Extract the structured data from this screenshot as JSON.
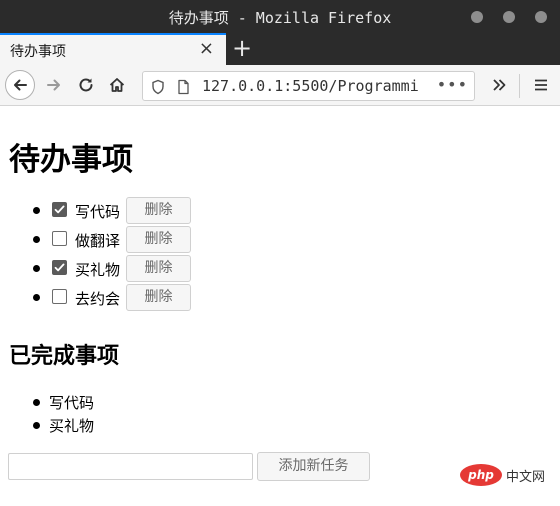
{
  "window": {
    "title": "待办事项 - Mozilla Firefox"
  },
  "tab": {
    "label": "待办事项",
    "close_glyph": "×",
    "new_tab_glyph": "+"
  },
  "navbar": {
    "url": "127.0.0.1:5500/Programmi",
    "more_glyph": "•••"
  },
  "page": {
    "title": "待办事项",
    "todos": [
      {
        "text": "写代码",
        "checked": true,
        "button": "删除"
      },
      {
        "text": "做翻译",
        "checked": false,
        "button": "删除"
      },
      {
        "text": "买礼物",
        "checked": true,
        "button": "删除"
      },
      {
        "text": "去约会",
        "checked": false,
        "button": "删除"
      }
    ],
    "done_title": "已完成事项",
    "done": [
      "写代码",
      "买礼物"
    ],
    "input_value": "",
    "add_button": "添加新任务"
  },
  "watermark": {
    "logo": "php",
    "text": "中文网"
  },
  "colors": {
    "titlebar": "#2b2b2b",
    "tab_accent": "#0a84ff",
    "watermark_red": "#e53935"
  }
}
